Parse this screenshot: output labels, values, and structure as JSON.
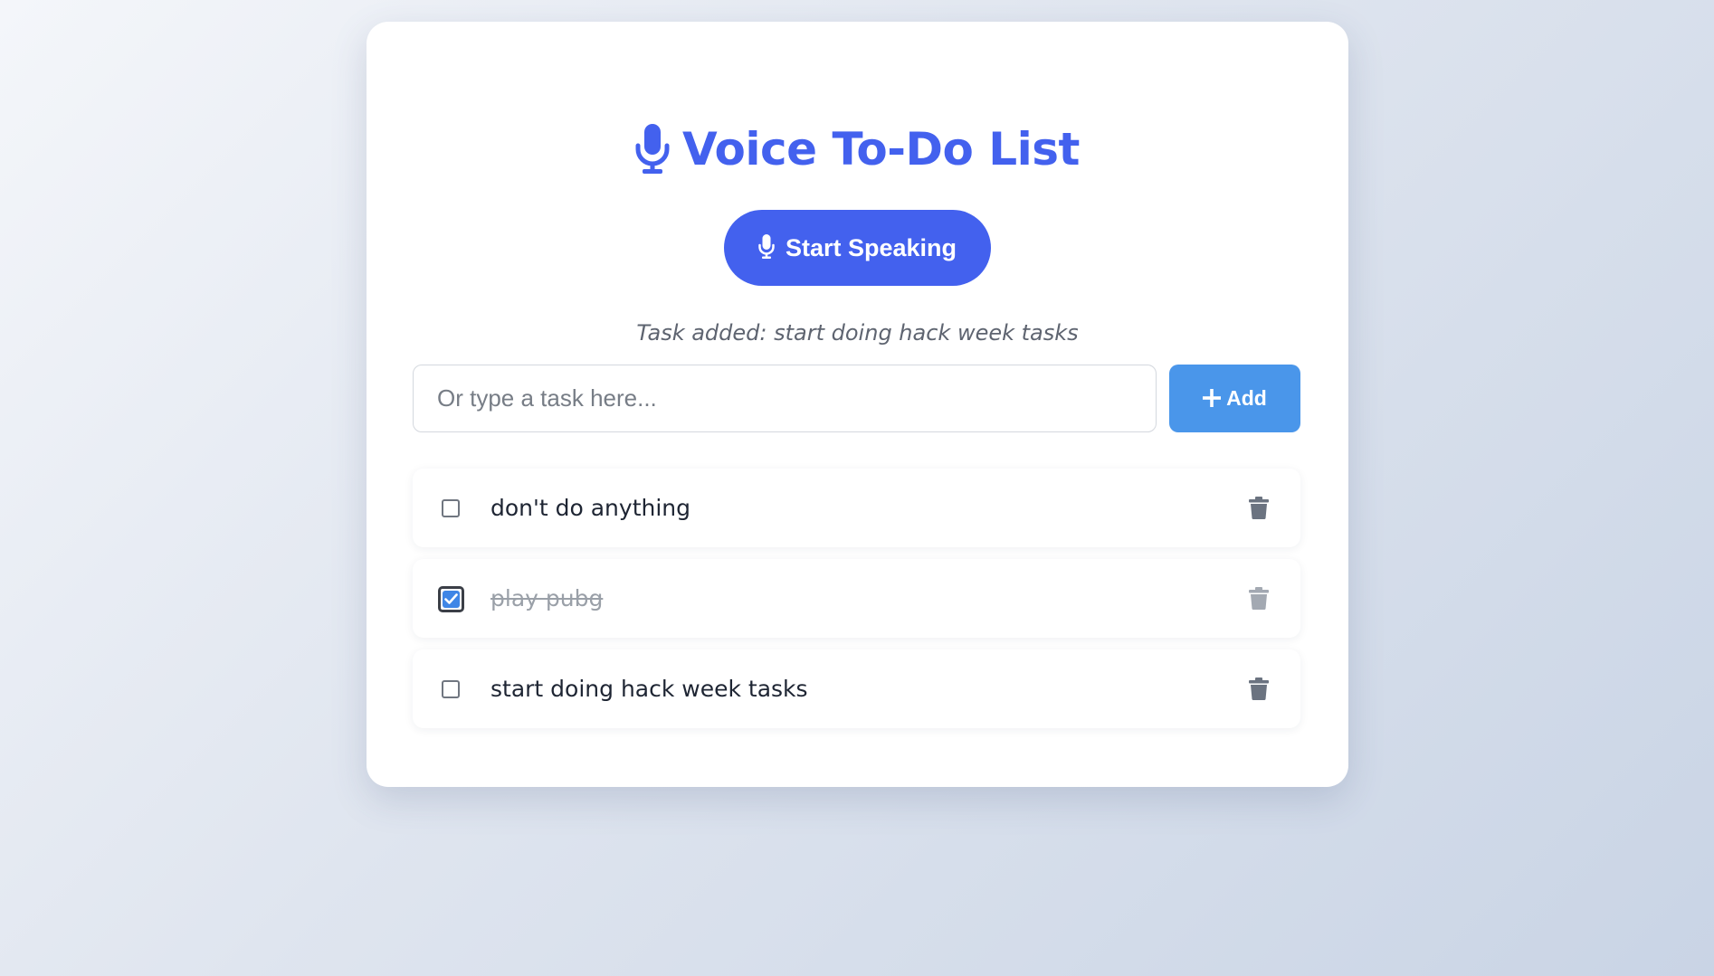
{
  "header": {
    "title": "Voice To-Do List",
    "title_icon": "microphone-icon",
    "accent_color": "#4361ee"
  },
  "speak_button": {
    "label": "Start Speaking",
    "icon": "microphone-icon",
    "color": "#4361ee"
  },
  "status": {
    "text": "Task added: start doing hack week tasks"
  },
  "task_input": {
    "value": "",
    "placeholder": "Or type a task here..."
  },
  "add_button": {
    "label": "Add",
    "icon": "plus-icon",
    "color": "#4a96ea"
  },
  "tasks": [
    {
      "text": "don't do anything",
      "completed": false,
      "delete_icon": "trash-icon"
    },
    {
      "text": "play pubg",
      "completed": true,
      "delete_icon": "trash-icon"
    },
    {
      "text": "start doing hack week tasks",
      "completed": false,
      "delete_icon": "trash-icon"
    }
  ]
}
